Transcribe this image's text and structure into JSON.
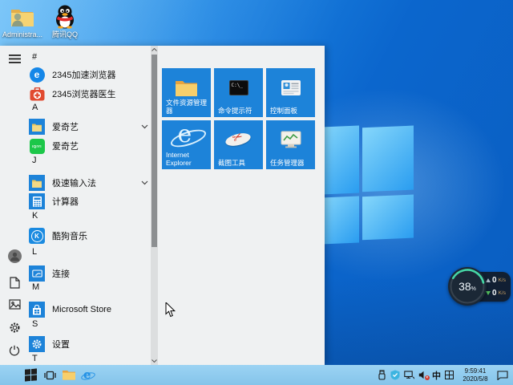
{
  "desktop_icons": [
    {
      "label": "Administra..."
    },
    {
      "label": "腾讯QQ"
    }
  ],
  "start_menu": {
    "sections": [
      {
        "header": "#",
        "items": [
          {
            "label": "2345加速浏览器",
            "glyph": "e"
          },
          {
            "label": "2345浏览器医生"
          }
        ]
      },
      {
        "header": "A",
        "items": [
          {
            "label": "爱奇艺",
            "expandable": true
          },
          {
            "label": "爱奇艺",
            "glyph": "IQIYI"
          }
        ]
      },
      {
        "header": "J",
        "items": [
          {
            "label": "极速输入法",
            "expandable": true
          },
          {
            "label": "计算器"
          }
        ]
      },
      {
        "header": "K",
        "items": [
          {
            "label": "酷狗音乐",
            "glyph": "K"
          }
        ]
      },
      {
        "header": "L",
        "items": [
          {
            "label": "连接"
          }
        ]
      },
      {
        "header": "M",
        "items": [
          {
            "label": "Microsoft Store"
          }
        ]
      },
      {
        "header": "S",
        "items": [
          {
            "label": "设置"
          }
        ]
      },
      {
        "header": "T",
        "items": []
      }
    ],
    "tiles": [
      {
        "label": "文件资源管理器"
      },
      {
        "label": "命令提示符",
        "glyph": "C:\\_"
      },
      {
        "label": "控制面板"
      },
      {
        "label": "Internet Explorer",
        "glyph": "e"
      },
      {
        "label": "截图工具",
        "glyph": "✂"
      },
      {
        "label": "任务管理器"
      }
    ]
  },
  "net_widget": {
    "percent": "38",
    "percent_unit": "%",
    "upload_value": "0",
    "upload_unit": "K/s",
    "download_value": "0",
    "download_unit": "K/s"
  },
  "taskbar": {
    "browser_glyph": "e",
    "tray": {
      "ime": "中"
    },
    "clock": {
      "time": "9:59:41",
      "date": "2020/5/8"
    }
  },
  "colors": {
    "accent_tile": "#1d83d9",
    "taskbar": "#8ecbee",
    "menu_bg": "#eff1f2",
    "desktop_blue": "#0b66cd",
    "arc_teal": "#45d6a5"
  }
}
